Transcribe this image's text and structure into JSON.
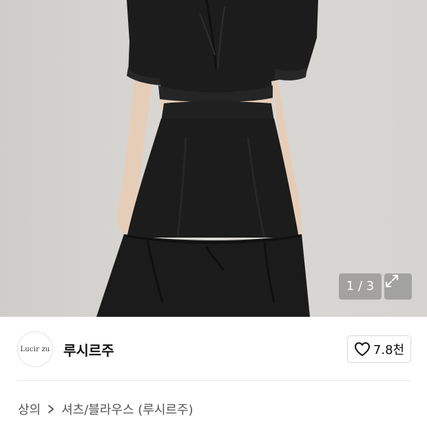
{
  "gallery": {
    "counter": "1 / 3",
    "expand_icon": "expand-icon"
  },
  "brand": {
    "logo_text": "Lucir zu",
    "name": "루시르주",
    "likes": "7.8천",
    "like_icon": "heart-icon"
  },
  "breadcrumb": {
    "category": "상의",
    "separator_icon": "chevron-right-icon",
    "subcategory": "셔츠/블라우스 (루시르주)"
  },
  "colors": {
    "garment": "#1b1c1b",
    "background": "#d6d4d1",
    "overlay": "#787878"
  }
}
